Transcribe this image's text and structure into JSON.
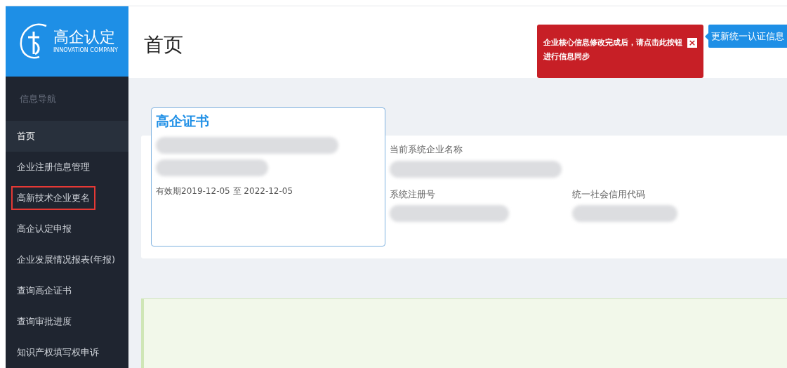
{
  "logo": {
    "title": "高企认定",
    "subtitle": "INNOVATION COMPANY"
  },
  "page_title": "首页",
  "alert": {
    "message": "企业核心信息修改完成后，请点击此按钮进行信息同步",
    "close": "×"
  },
  "sync_button": "更新统一认证信息",
  "sidebar": {
    "heading": "信息导航",
    "items": [
      {
        "label": "首页",
        "selected": true,
        "outlined": false
      },
      {
        "label": "企业注册信息管理",
        "selected": false,
        "outlined": false
      },
      {
        "label": "高新技术企业更名",
        "selected": false,
        "outlined": true
      },
      {
        "label": "高企认定申报",
        "selected": false,
        "outlined": false
      },
      {
        "label": "企业发展情况报表(年报)",
        "selected": false,
        "outlined": false
      },
      {
        "label": "查询高企证书",
        "selected": false,
        "outlined": false
      },
      {
        "label": "查询审批进度",
        "selected": false,
        "outlined": false
      },
      {
        "label": "知识产权填写权申诉",
        "selected": false,
        "outlined": false
      }
    ]
  },
  "certificate": {
    "title": "高企证书",
    "validity": "有效期2019-12-05 至 2022-12-05"
  },
  "company_info": {
    "name_label": "当前系统企业名称",
    "reg_label": "系统注册号",
    "credit_label": "统一社会信用代码"
  }
}
